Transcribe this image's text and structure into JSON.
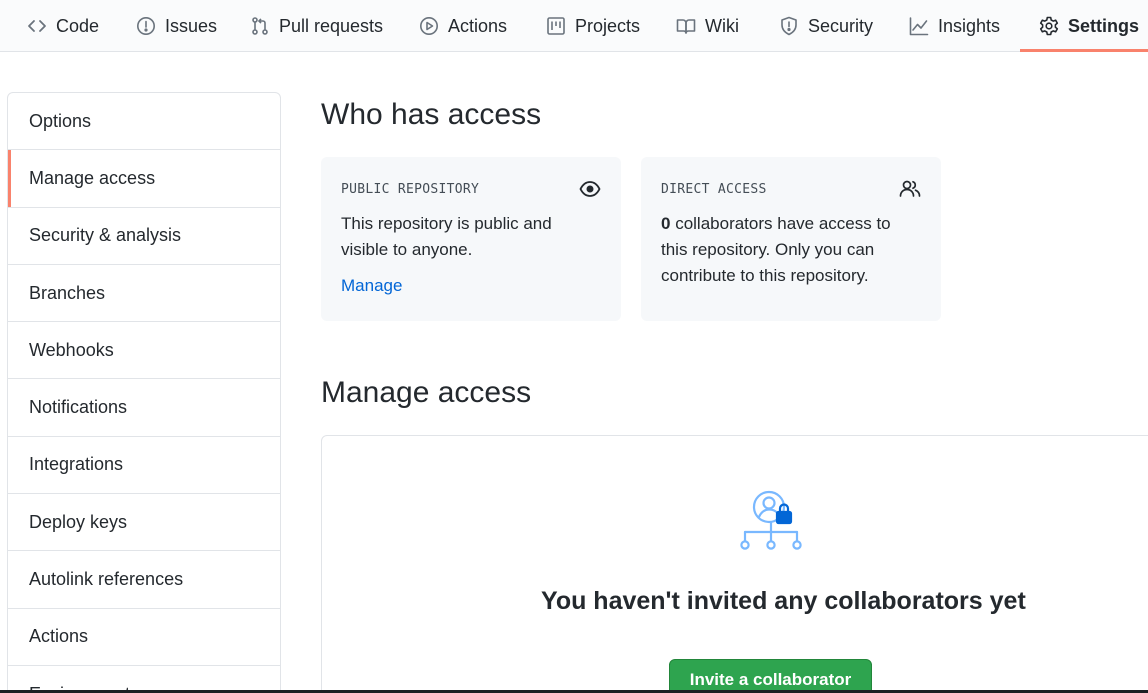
{
  "nav": {
    "tabs": [
      {
        "label": "Code",
        "icon": "code-icon"
      },
      {
        "label": "Issues",
        "icon": "issue-icon"
      },
      {
        "label": "Pull requests",
        "icon": "pull-request-icon"
      },
      {
        "label": "Actions",
        "icon": "play-icon"
      },
      {
        "label": "Projects",
        "icon": "project-icon"
      },
      {
        "label": "Wiki",
        "icon": "book-icon"
      },
      {
        "label": "Security",
        "icon": "shield-icon"
      },
      {
        "label": "Insights",
        "icon": "graph-icon"
      },
      {
        "label": "Settings",
        "icon": "gear-icon"
      }
    ],
    "selected": "Settings",
    "accent_color": "#f9826c"
  },
  "sidebar": {
    "items": [
      {
        "label": "Options"
      },
      {
        "label": "Manage access"
      },
      {
        "label": "Security & analysis"
      },
      {
        "label": "Branches"
      },
      {
        "label": "Webhooks"
      },
      {
        "label": "Notifications"
      },
      {
        "label": "Integrations"
      },
      {
        "label": "Deploy keys"
      },
      {
        "label": "Autolink references"
      },
      {
        "label": "Actions"
      },
      {
        "label": "Environments"
      }
    ],
    "selected": "Manage access"
  },
  "who_has_access": {
    "title": "Who has access",
    "public_card": {
      "label": "PUBLIC REPOSITORY",
      "icon": "eye-icon",
      "text": "This repository is public and visible to anyone.",
      "link": "Manage"
    },
    "direct_card": {
      "label": "DIRECT ACCESS",
      "icon": "people-icon",
      "count": "0",
      "text": " collaborators have access to this repository. Only you can contribute to this repository."
    }
  },
  "manage_access": {
    "title": "Manage access",
    "illustration_icon": "collaborator-lock-icon",
    "empty_title": "You haven't invited any collaborators yet",
    "invite_button": "Invite a collaborator",
    "button_color": "#2ea44f",
    "link_color": "#0366d6"
  }
}
